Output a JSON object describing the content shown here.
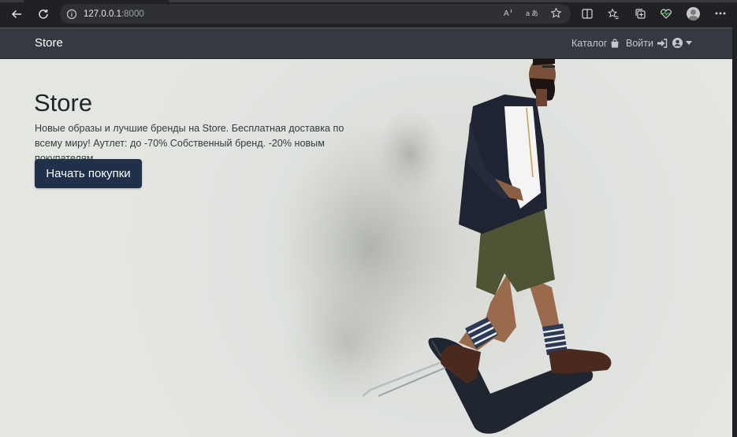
{
  "browser": {
    "url_host": "127.0.0.1",
    "url_port": ":8000",
    "icons": [
      "back-icon",
      "reload-icon",
      "site-info-icon",
      "read-aloud-icon",
      "translate-icon",
      "favorite-icon",
      "split-screen-icon",
      "favorites-list-icon",
      "collections-icon",
      "browser-essentials-icon",
      "profile-icon",
      "more-icon"
    ]
  },
  "navbar": {
    "brand": "Store",
    "catalog_label": "Каталог",
    "login_label": "Войти"
  },
  "hero": {
    "title": "Store",
    "text": "Новые образы и лучшие бренды на Store. Бесплатная доставка по всему миру! Аутлет: до -70% Собственный бренд. -20% новым покупателям.",
    "cta_label": "Начать покупки"
  },
  "colors": {
    "navbar_bg": "#343a40",
    "cta_bg": "#20304a",
    "hero_bg": "#dde0dc"
  }
}
